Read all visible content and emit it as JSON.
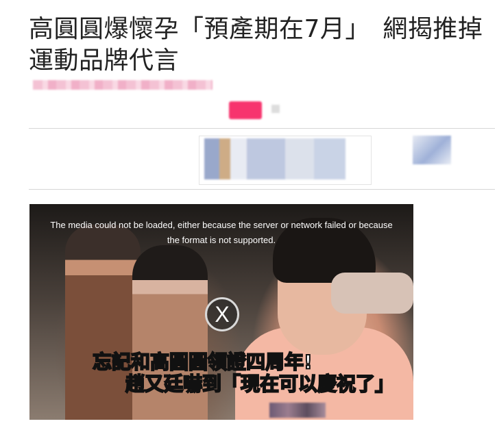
{
  "article": {
    "headline": "高圓圓爆懷孕「預產期在7月」　網揭推掉運動品牌代言"
  },
  "video": {
    "error_message": "The media could not be loaded, either because the server or network failed or because the format is not supported.",
    "close_symbol": "X",
    "caption_line1_pre": "忘記和",
    "caption_line1_highlight": "高圓圓",
    "caption_line1_post": "領證四周年!",
    "caption_line2_pre": "趙又廷",
    "caption_line2_post": "嚇到「現在可以慶祝了」"
  },
  "colors": {
    "accent": "#f7346e",
    "caption_highlight": "#e8427a",
    "caption_cyan": "#21c7d8"
  },
  "icons": {
    "close": "close-icon",
    "share": "share-icon"
  }
}
